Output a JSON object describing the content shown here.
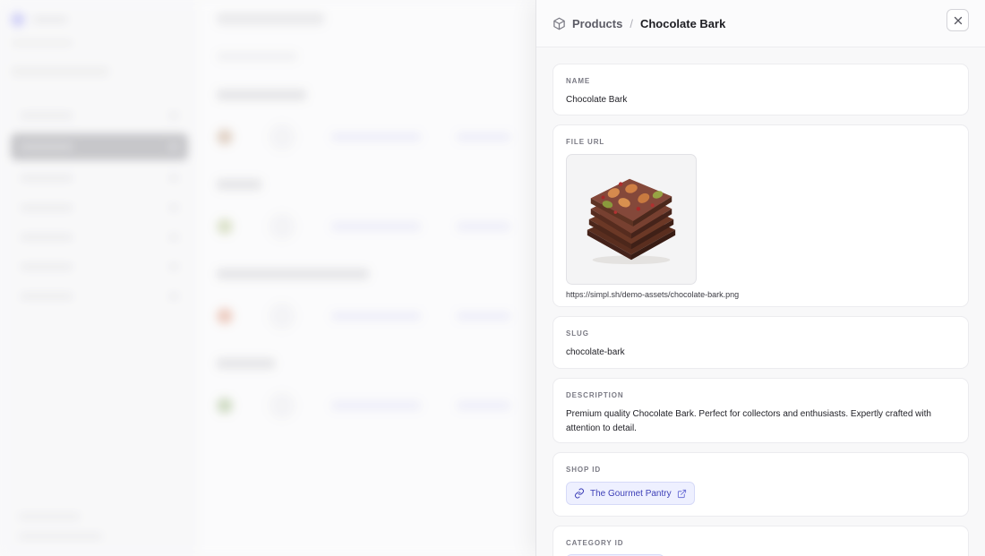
{
  "breadcrumb": {
    "parent": "Products",
    "separator": "/",
    "current": "Chocolate Bark"
  },
  "fields": {
    "name": {
      "label": "NAME",
      "value": "Chocolate Bark"
    },
    "file_url": {
      "label": "FILE URL",
      "value": "https://simpl.sh/demo-assets/chocolate-bark.png"
    },
    "slug": {
      "label": "SLUG",
      "value": "chocolate-bark"
    },
    "description": {
      "label": "DESCRIPTION",
      "value": "Premium quality Chocolate Bark. Perfect for collectors and enthusiasts. Expertly crafted with attention to detail."
    },
    "shop_id": {
      "label": "SHOP ID",
      "value": "The Gourmet Pantry"
    },
    "category_id": {
      "label": "CATEGORY ID"
    }
  },
  "icons": {
    "breadcrumb": "cube-icon",
    "close": "close-icon",
    "shop_link": "link-icon",
    "shop_external": "external-link-icon"
  },
  "colors": {
    "link_text": "#3d3fb7",
    "link_bg": "#eef0ff",
    "chocolate": "#5e3323"
  }
}
